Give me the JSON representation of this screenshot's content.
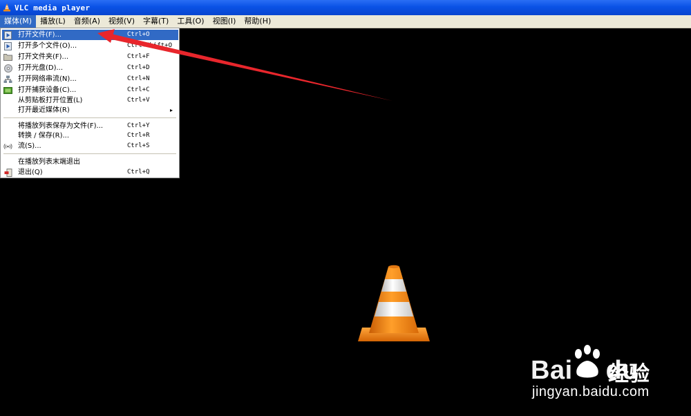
{
  "window": {
    "title": "VLC media player"
  },
  "menubar": {
    "items": [
      {
        "label": "媒体(M)",
        "active": true
      },
      {
        "label": "播放(L)",
        "active": false
      },
      {
        "label": "音频(A)",
        "active": false
      },
      {
        "label": "视频(V)",
        "active": false
      },
      {
        "label": "字幕(T)",
        "active": false
      },
      {
        "label": "工具(O)",
        "active": false
      },
      {
        "label": "视图(I)",
        "active": false
      },
      {
        "label": "帮助(H)",
        "active": false
      }
    ]
  },
  "media_menu": {
    "items": [
      {
        "label": "打开文件(F)...",
        "shortcut": "Ctrl+O",
        "icon": "play-file-icon",
        "highlighted": true
      },
      {
        "label": "打开多个文件(O)...",
        "shortcut": "Ctrl+Shift+O",
        "icon": "multiple-files-icon"
      },
      {
        "label": "打开文件夹(F)...",
        "shortcut": "Ctrl+F",
        "icon": "folder-icon"
      },
      {
        "label": "打开光盘(D)...",
        "shortcut": "Ctrl+D",
        "icon": "disc-icon"
      },
      {
        "label": "打开网络串流(N)...",
        "shortcut": "Ctrl+N",
        "icon": "network-icon"
      },
      {
        "label": "打开捕获设备(C)...",
        "shortcut": "Ctrl+C",
        "icon": "capture-device-icon"
      },
      {
        "label": "从剪贴板打开位置(L)",
        "shortcut": "Ctrl+V",
        "icon": ""
      },
      {
        "label": "打开最近媒体(R)",
        "shortcut": "",
        "icon": "",
        "submenu": true
      },
      {
        "label": "将播放列表保存为文件(F)...",
        "shortcut": "Ctrl+Y",
        "icon": ""
      },
      {
        "label": "转换 / 保存(R)...",
        "shortcut": "Ctrl+R",
        "icon": ""
      },
      {
        "label": "流(S)...",
        "shortcut": "Ctrl+S",
        "icon": "stream-icon"
      },
      {
        "label": "在播放列表末端退出",
        "shortcut": "",
        "icon": ""
      },
      {
        "label": "退出(Q)",
        "shortcut": "Ctrl+Q",
        "icon": "exit-icon"
      }
    ],
    "submenu_arrow": "▸"
  },
  "watermark": {
    "brand": "Bai",
    "brand_suffix": "du",
    "chinese": "经验",
    "url": "jingyan.baidu.com"
  },
  "colors": {
    "titlebar": "#0a52e6",
    "menu_highlight": "#316ac5",
    "arrow": "#e8262c",
    "cone_orange": "#f08a1c"
  }
}
